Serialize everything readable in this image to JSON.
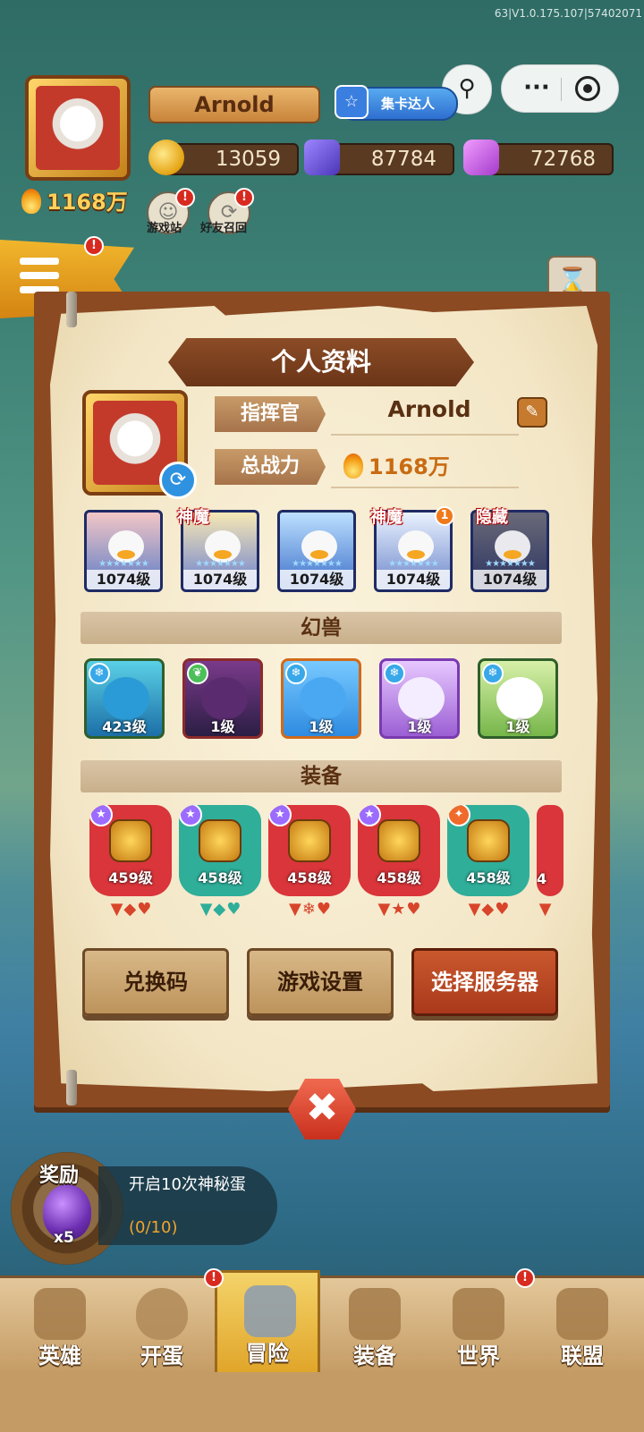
{
  "version": "63|V1.0.175.107|57402071",
  "player": {
    "name": "Arnold",
    "power": "1168万",
    "badge": "集卡达人"
  },
  "resources": {
    "gold": "13059",
    "crystal": "87784",
    "gem": "72768"
  },
  "side_buttons": [
    {
      "label": "游戏站"
    },
    {
      "label": "好友召回"
    }
  ],
  "profile": {
    "title": "个人资料",
    "commander_label": "指挥官",
    "commander_name": "Arnold",
    "power_label": "总战力",
    "power_value": "1168万",
    "heroes": [
      {
        "level": "1074级",
        "tag": "",
        "colors": [
          "#f3c6c6",
          "#5c7cc7"
        ]
      },
      {
        "level": "1074级",
        "tag": "神魔",
        "colors": [
          "#f7e8b4",
          "#6a7fd0"
        ]
      },
      {
        "level": "1074级",
        "tag": "",
        "colors": [
          "#bde0ff",
          "#3d70c9"
        ]
      },
      {
        "level": "1074级",
        "tag": "神魔",
        "badge": "1",
        "colors": [
          "#eaf2ff",
          "#6c86c9"
        ]
      },
      {
        "level": "1074级",
        "tag": "隐藏",
        "colors": [
          "#6a6a78",
          "#2c3362"
        ]
      }
    ],
    "beasts_label": "幻兽",
    "beasts": [
      {
        "level": "423级",
        "colors": [
          "#5ad0e6",
          "#1c6fa7"
        ]
      },
      {
        "level": "1级",
        "colors": [
          "#7a3a8a",
          "#2b1e44"
        ]
      },
      {
        "level": "1级",
        "colors": [
          "#77c9ff",
          "#2e8be0"
        ]
      },
      {
        "level": "1级",
        "colors": [
          "#e7c8ff",
          "#9b5fd4"
        ]
      },
      {
        "level": "1级",
        "colors": [
          "#d7f0a8",
          "#76b64a"
        ]
      }
    ],
    "equipment_label": "装备",
    "equipment": [
      {
        "level": "459级",
        "bg": "#d9353a",
        "gems": "▼◆♥"
      },
      {
        "level": "458级",
        "bg": "#2fae9a",
        "gems": "▼◆♥"
      },
      {
        "level": "458级",
        "bg": "#d9353a",
        "gems": "▼❄♥"
      },
      {
        "level": "458级",
        "bg": "#d9353a",
        "gems": "▼★♥"
      },
      {
        "level": "458级",
        "bg": "#2fae9a",
        "gems": "▼◆♥"
      },
      {
        "level": "4",
        "bg": "#d9353a",
        "gems": "▼"
      }
    ],
    "buttons": {
      "redeem": "兑换码",
      "settings": "游戏设置",
      "server": "选择服务器"
    }
  },
  "reward": {
    "title": "奖励",
    "count": "x5",
    "task": "开启10次神秘蛋",
    "progress": "(0/10)"
  },
  "nav": [
    {
      "label": "英雄",
      "badge": ""
    },
    {
      "label": "开蛋",
      "badge": ""
    },
    {
      "label": "冒险",
      "badge": "!"
    },
    {
      "label": "装备",
      "badge": ""
    },
    {
      "label": "世界",
      "badge": "!"
    },
    {
      "label": "联盟",
      "badge": ""
    }
  ],
  "colors": {
    "accent": "#8b4a22",
    "parchment": "#f3e6c6",
    "active_tab": "#f4d36a",
    "alert": "#d82a1f"
  }
}
